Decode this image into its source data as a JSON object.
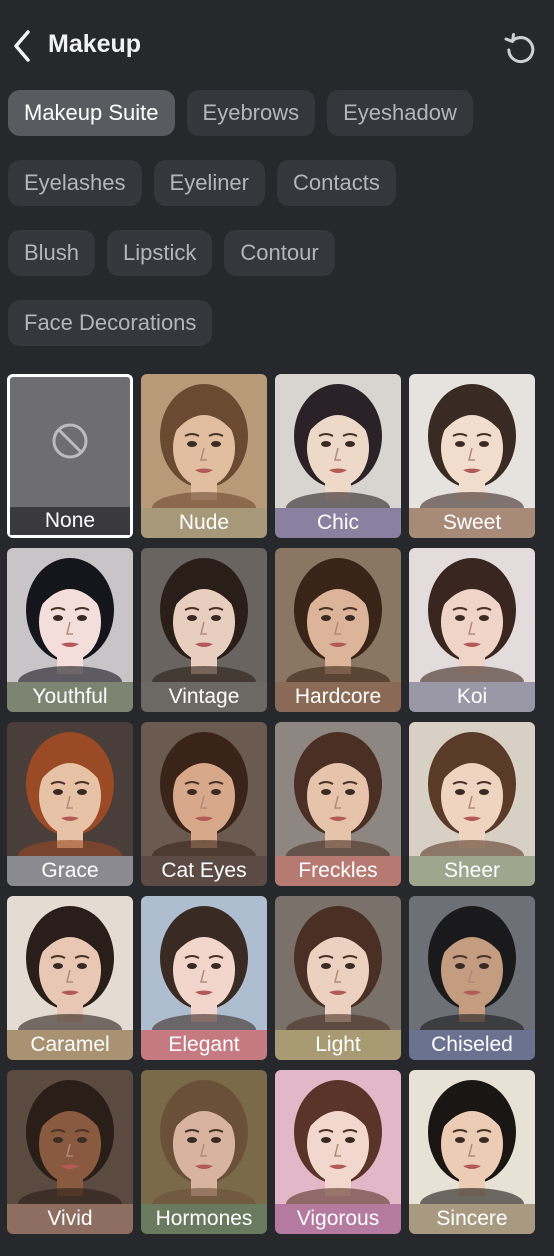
{
  "header": {
    "title": "Makeup"
  },
  "chip_rows": [
    [
      {
        "label": "Makeup Suite",
        "active": true
      },
      {
        "label": "Eyebrows"
      },
      {
        "label": "Eyeshadow"
      }
    ],
    [
      {
        "label": "Eyelashes"
      },
      {
        "label": "Eyeliner"
      },
      {
        "label": "Contacts"
      }
    ],
    [
      {
        "label": "Blush"
      },
      {
        "label": "Lipstick"
      },
      {
        "label": "Contour"
      }
    ],
    [
      {
        "label": "Face Decorations"
      }
    ]
  ],
  "presets": [
    {
      "label": "None",
      "selected": true
    },
    {
      "label": "Nude",
      "bg": "#b89a78",
      "skin": "#e2bea0",
      "hair": "#6a4a30",
      "cap": "#a8987a"
    },
    {
      "label": "Chic",
      "bg": "#d8d4d0",
      "skin": "#eed8c8",
      "hair": "#2a2226",
      "cap": "#8a80a0"
    },
    {
      "label": "Sweet",
      "bg": "#e6e2de",
      "skin": "#f2dccc",
      "hair": "#3a2a24",
      "cap": "#a88a78"
    },
    {
      "label": "Youthful",
      "bg": "#c8c4c8",
      "skin": "#f4dedc",
      "hair": "#15151c",
      "cap": "#7e8472"
    },
    {
      "label": "Vintage",
      "bg": "#6a6460",
      "skin": "#e8cebe",
      "hair": "#2a1e18",
      "cap": "#6c6864"
    },
    {
      "label": "Hardcore",
      "bg": "#8a7662",
      "skin": "#dcb49a",
      "hair": "#3a2418",
      "cap": "#8a6a56"
    },
    {
      "label": "Koi",
      "bg": "#e4dcdc",
      "skin": "#f0d4c8",
      "hair": "#3a2620",
      "cap": "#9a98a6"
    },
    {
      "label": "Grace",
      "bg": "#4a3e3a",
      "skin": "#e8c2a6",
      "hair": "#9a4a24",
      "cap": "#8a8a90"
    },
    {
      "label": "Cat Eyes",
      "bg": "#6a5a50",
      "skin": "#d8a88a",
      "hair": "#3a241a",
      "cap": "#5c4a44"
    },
    {
      "label": "Freckles",
      "bg": "#8e8680",
      "skin": "#e6c4ac",
      "hair": "#4a3024",
      "cap": "#b67a72"
    },
    {
      "label": "Sheer",
      "bg": "#d8d0c4",
      "skin": "#f0d4c2",
      "hair": "#5a3a28",
      "cap": "#9ea68e"
    },
    {
      "label": "Caramel",
      "bg": "#e4dcd2",
      "skin": "#e8c8b4",
      "hair": "#2a1e1a",
      "cap": "#a89272"
    },
    {
      "label": "Elegant",
      "bg": "#aebed0",
      "skin": "#f2d6cc",
      "hair": "#3a2a24",
      "cap": "#c47a80"
    },
    {
      "label": "Light",
      "bg": "#7a726a",
      "skin": "#ecd0c0",
      "hair": "#4a3024",
      "cap": "#a89a72"
    },
    {
      "label": "Chiseled",
      "bg": "#6e7078",
      "skin": "#c49c80",
      "hair": "#1a1a1c",
      "cap": "#6a7290"
    },
    {
      "label": "Vivid",
      "bg": "#5a4a40",
      "skin": "#8a5a40",
      "hair": "#2a1e18",
      "cap": "#8e6e60"
    },
    {
      "label": "Hormones",
      "bg": "#7a6a4a",
      "skin": "#d8b4a0",
      "hair": "#6a5038",
      "cap": "#6a7a5e"
    },
    {
      "label": "Vigorous",
      "bg": "#e2b8c8",
      "skin": "#f2d8cc",
      "hair": "#5a3428",
      "cap": "#b47aa0"
    },
    {
      "label": "Sincere",
      "bg": "#e8e2d6",
      "skin": "#ecccb4",
      "hair": "#1a1614",
      "cap": "#a89a80"
    }
  ],
  "accent": "#ffffff"
}
